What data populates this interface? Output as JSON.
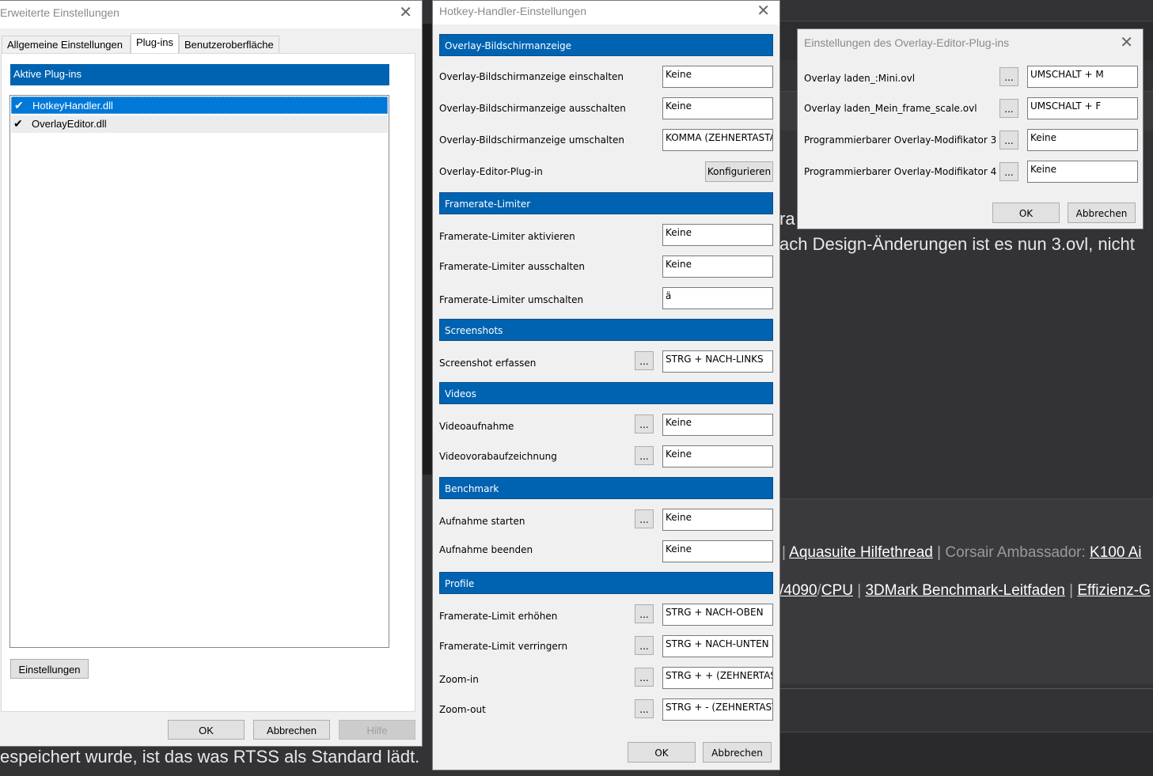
{
  "background": {
    "line1": "ach Design-Änderungen ist es nun 3.ovl, nicht",
    "line1_prefix": "ra",
    "links_row1": {
      "sep1": "|",
      "link1": "Aquasuite Hilfethread",
      "sep2": "|",
      "muted": "Corsair Ambassador:",
      "link2": "K100 Ai"
    },
    "links_row2": {
      "link1": "/4090",
      "sep1": "/",
      "link2": "CPU",
      "sep2": "|",
      "link3": "3DMark Benchmark-Leitfaden",
      "sep3": "|",
      "link4": "Effizienz-G"
    },
    "bottom_line": "espeichert wurde, ist das was RTSS als Standard lädt."
  },
  "left_window": {
    "title": "Erweiterte Einstellungen",
    "close": "✕",
    "tabs": [
      "Allgemeine Einstellungen",
      "Plug-ins",
      "Benutzeroberfläche"
    ],
    "section_header": "Aktive Plug-ins",
    "plugins": [
      {
        "name": "HotkeyHandler.dll",
        "checked": true,
        "selected": true
      },
      {
        "name": "OverlayEditor.dll",
        "checked": true,
        "selected": false
      }
    ],
    "settings_button": "Einstellungen",
    "ok_button": "OK",
    "cancel_button": "Abbrechen",
    "help_button": "Hilfe"
  },
  "hotkey_window": {
    "title": "Hotkey-Handler-Einstellungen",
    "close": "✕",
    "sections": {
      "overlay": "Overlay-Bildschirmanzeige",
      "framerate": "Framerate-Limiter",
      "screenshots": "Screenshots",
      "videos": "Videos",
      "benchmark": "Benchmark",
      "profile": "Profile"
    },
    "rows": {
      "osd_on": {
        "label": "Overlay-Bildschirmanzeige einschalten",
        "value": "Keine"
      },
      "osd_off": {
        "label": "Overlay-Bildschirmanzeige ausschalten",
        "value": "Keine"
      },
      "osd_toggle": {
        "label": "Overlay-Bildschirmanzeige umschalten",
        "value": "KOMMA (ZEHNERTASTATUR)"
      },
      "editor": {
        "label": "Overlay-Editor-Plug-in",
        "button": "Konfigurieren"
      },
      "fl_on": {
        "label": "Framerate-Limiter aktivieren",
        "value": "Keine"
      },
      "fl_off": {
        "label": "Framerate-Limiter ausschalten",
        "value": "Keine"
      },
      "fl_toggle": {
        "label": "Framerate-Limiter umschalten",
        "value": "ä"
      },
      "screenshot": {
        "label": "Screenshot erfassen",
        "value": "STRG + NACH-LINKS"
      },
      "video": {
        "label": "Videoaufnahme",
        "value": "Keine"
      },
      "prerecord": {
        "label": "Videovorabaufzeichnung",
        "value": "Keine"
      },
      "bench_start": {
        "label": "Aufnahme starten",
        "value": "Keine"
      },
      "bench_stop": {
        "label": "Aufnahme beenden",
        "value": "Keine"
      },
      "fl_up": {
        "label": "Framerate-Limit erhöhen",
        "value": "STRG + NACH-OBEN"
      },
      "fl_down": {
        "label": "Framerate-Limit verringern",
        "value": "STRG + NACH-UNTEN"
      },
      "zoom_in": {
        "label": "Zoom-in",
        "value": "STRG + + (ZEHNERTASTATUR)"
      },
      "zoom_out": {
        "label": "Zoom-out",
        "value": "STRG + - (ZEHNERTASTATUR)"
      }
    },
    "dots": "...",
    "ok_button": "OK",
    "cancel_button": "Abbrechen"
  },
  "editor_window": {
    "title": "Einstellungen des Overlay-Editor-Plug-ins",
    "close": "✕",
    "rows": [
      {
        "label": "Overlay laden_:Mini.ovl",
        "value": "UMSCHALT + M"
      },
      {
        "label": "Overlay laden_Mein_frame_scale.ovl",
        "value": "UMSCHALT + F"
      },
      {
        "label": "Programmierbarer Overlay-Modifikator 3",
        "value": "Keine"
      },
      {
        "label": "Programmierbarer Overlay-Modifikator 4",
        "value": "Keine"
      }
    ],
    "dots": "...",
    "ok_button": "OK",
    "cancel_button": "Abbrechen"
  }
}
